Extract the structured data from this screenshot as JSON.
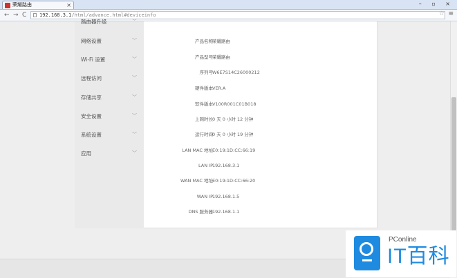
{
  "browser": {
    "tab_title": "荣耀路由",
    "tab_close": "×",
    "window_controls": "– ▫ ×",
    "back": "←",
    "forward": "→",
    "reload": "C",
    "url_host": "192.168.3.1",
    "url_path": "/html/advance.html#deviceinfo",
    "star": "☆",
    "menu": "≡"
  },
  "sidebar": {
    "chevron": "﹀",
    "items": [
      {
        "label": "路由器升级"
      },
      {
        "label": "网络设置"
      },
      {
        "label": "Wi-Fi 设置"
      },
      {
        "label": "远程访问"
      },
      {
        "label": "存储共享"
      },
      {
        "label": "安全设置"
      },
      {
        "label": "系统设置"
      },
      {
        "label": "应用"
      }
    ]
  },
  "device_info": [
    {
      "label": "产品名称",
      "value": "荣耀路由"
    },
    {
      "label": "产品型号",
      "value": "荣耀路由"
    },
    {
      "label": "序列号",
      "value": "W6E7S14C26000212"
    },
    {
      "label": "硬件版本",
      "value": "VER.A"
    },
    {
      "label": "软件版本",
      "value": "V100R001C01B018"
    },
    {
      "label": "上网时长",
      "value": "0 天 0 小时 12 分钟"
    },
    {
      "label": "运行时间",
      "value": "0 天 0 小时 19 分钟"
    },
    {
      "label": "LAN MAC 地址",
      "value": "E0:19:1D:CC:66:19"
    },
    {
      "label": "LAN IP",
      "value": "192.168.3.1"
    },
    {
      "label": "WAN MAC 地址",
      "value": "E0:19:1D:CC:66:20"
    },
    {
      "label": "WAN IP",
      "value": "192.168.1.5"
    },
    {
      "label": "DNS 服务器",
      "value": "192.168.1.1"
    }
  ],
  "watermark": {
    "brand_small": "PConline",
    "brand_big": "IT百科"
  }
}
